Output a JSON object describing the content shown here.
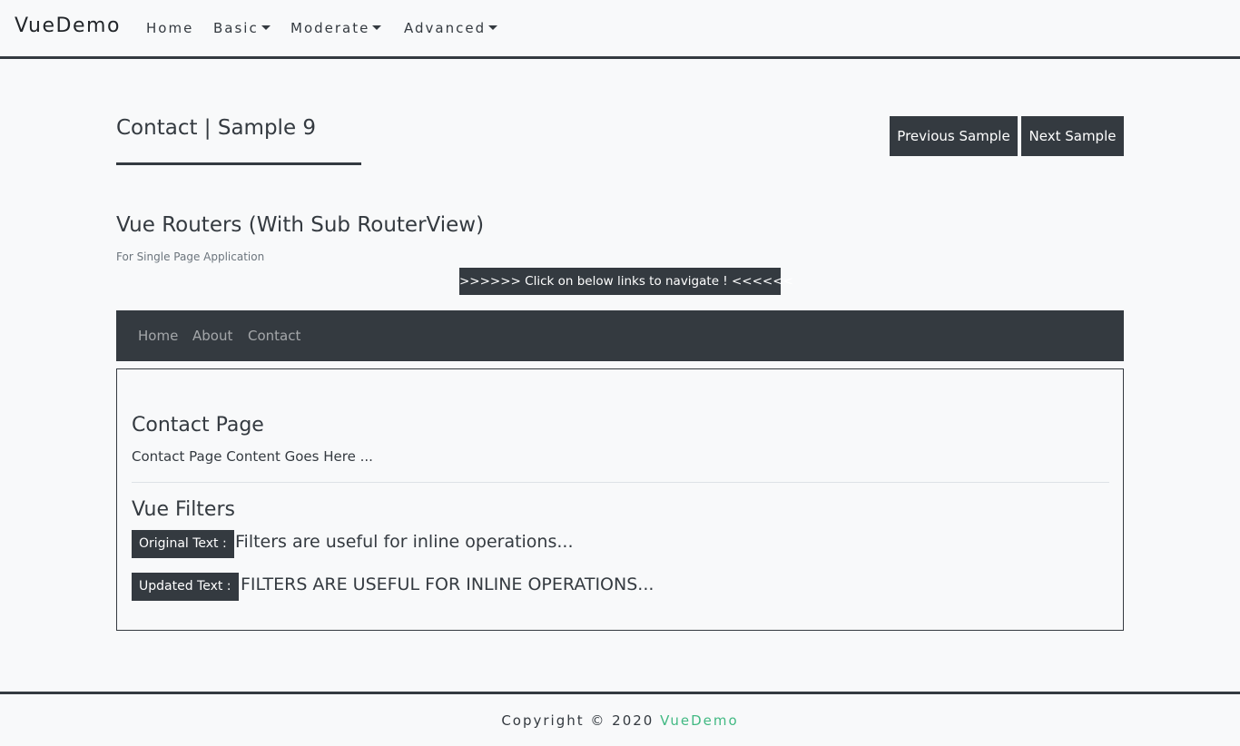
{
  "navbar": {
    "brand": "VueDemo",
    "items": [
      {
        "label": "Home",
        "dropdown": false
      },
      {
        "label": "Basic",
        "dropdown": true
      },
      {
        "label": "Moderate",
        "dropdown": true
      },
      {
        "label": "Advanced",
        "dropdown": true
      }
    ]
  },
  "header": {
    "title": "Contact | Sample 9",
    "prev_label": "Previous Sample",
    "next_label": "Next Sample"
  },
  "section": {
    "title": "Vue Routers (With Sub RouterView)",
    "subtitle": "For Single Page Application",
    "hint": ">>>>>> Click on below links to navigate ! <<<<<<"
  },
  "subnav": {
    "links": [
      "Home",
      "About",
      "Contact"
    ]
  },
  "router_view": {
    "page_title": "Contact Page",
    "page_content": "Contact Page Content Goes Here ...",
    "filters_title": "Vue Filters",
    "original_label": "Original Text :",
    "original_value": "Filters are useful for inline operations...",
    "updated_label": "Updated Text :",
    "updated_value": "FILTERS ARE USEFUL FOR INLINE OPERATIONS..."
  },
  "footer": {
    "copyright": "Copyright © 2020",
    "link": "VueDemo"
  },
  "colors": {
    "background": "#f8f9fa",
    "dark": "#343a40",
    "accent": "#42b983"
  }
}
